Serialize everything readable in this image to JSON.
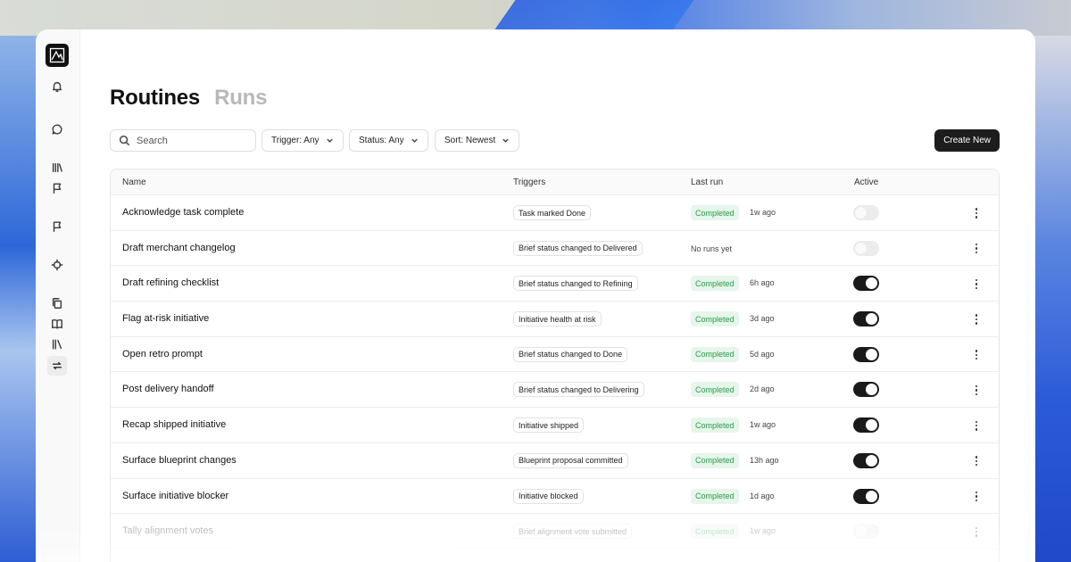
{
  "tabs": [
    {
      "label": "Routines",
      "active": true
    },
    {
      "label": "Runs",
      "active": false
    }
  ],
  "search": {
    "placeholder": "Search"
  },
  "filters": [
    {
      "label": "Trigger: Any"
    },
    {
      "label": "Status: Any"
    },
    {
      "label": "Sort: Newest"
    }
  ],
  "create_button": {
    "label": "Create New"
  },
  "table": {
    "headers": {
      "name": "Name",
      "triggers": "Triggers",
      "last_run": "Last run",
      "active": "Active"
    },
    "rows": [
      {
        "name": "Acknowledge task complete",
        "trigger": "Task marked Done",
        "status": "Completed",
        "ago": "1w ago",
        "active": false
      },
      {
        "name": "Draft merchant changelog",
        "trigger": "Brief status changed to Delivered",
        "status": "",
        "ago": "No runs yet",
        "active": false
      },
      {
        "name": "Draft refining checklist",
        "trigger": "Brief status changed to Refining",
        "status": "Completed",
        "ago": "6h ago",
        "active": true
      },
      {
        "name": "Flag at-risk initiative",
        "trigger": "Initiative health at risk",
        "status": "Completed",
        "ago": "3d ago",
        "active": true
      },
      {
        "name": "Open retro prompt",
        "trigger": "Brief status changed to Done",
        "status": "Completed",
        "ago": "5d ago",
        "active": true
      },
      {
        "name": "Post delivery handoff",
        "trigger": "Brief status changed to Delivering",
        "status": "Completed",
        "ago": "2d ago",
        "active": true
      },
      {
        "name": "Recap shipped initiative",
        "trigger": "Initiative shipped",
        "status": "Completed",
        "ago": "1w ago",
        "active": true
      },
      {
        "name": "Surface blueprint changes",
        "trigger": "Blueprint proposal committed",
        "status": "Completed",
        "ago": "13h ago",
        "active": true
      },
      {
        "name": "Surface initiative blocker",
        "trigger": "Initiative blocked",
        "status": "Completed",
        "ago": "1d ago",
        "active": true
      },
      {
        "name": "Tally alignment votes",
        "trigger": "Brief alignment vote submitted",
        "status": "Completed",
        "ago": "1w ago",
        "active": false
      }
    ]
  },
  "sidebar": {
    "icons": [
      "bell-icon",
      "chat-icon",
      "library-icon",
      "flag-icon",
      "flag-icon",
      "crosshair-icon",
      "copy-icon",
      "book-icon",
      "books-icon",
      "repeat-icon"
    ]
  },
  "colors": {
    "status_bg": "#e6f6ea",
    "status_text": "#2a9a4a",
    "toggle_on": "#1a1a1a",
    "primary_button": "#1d1d1d"
  }
}
